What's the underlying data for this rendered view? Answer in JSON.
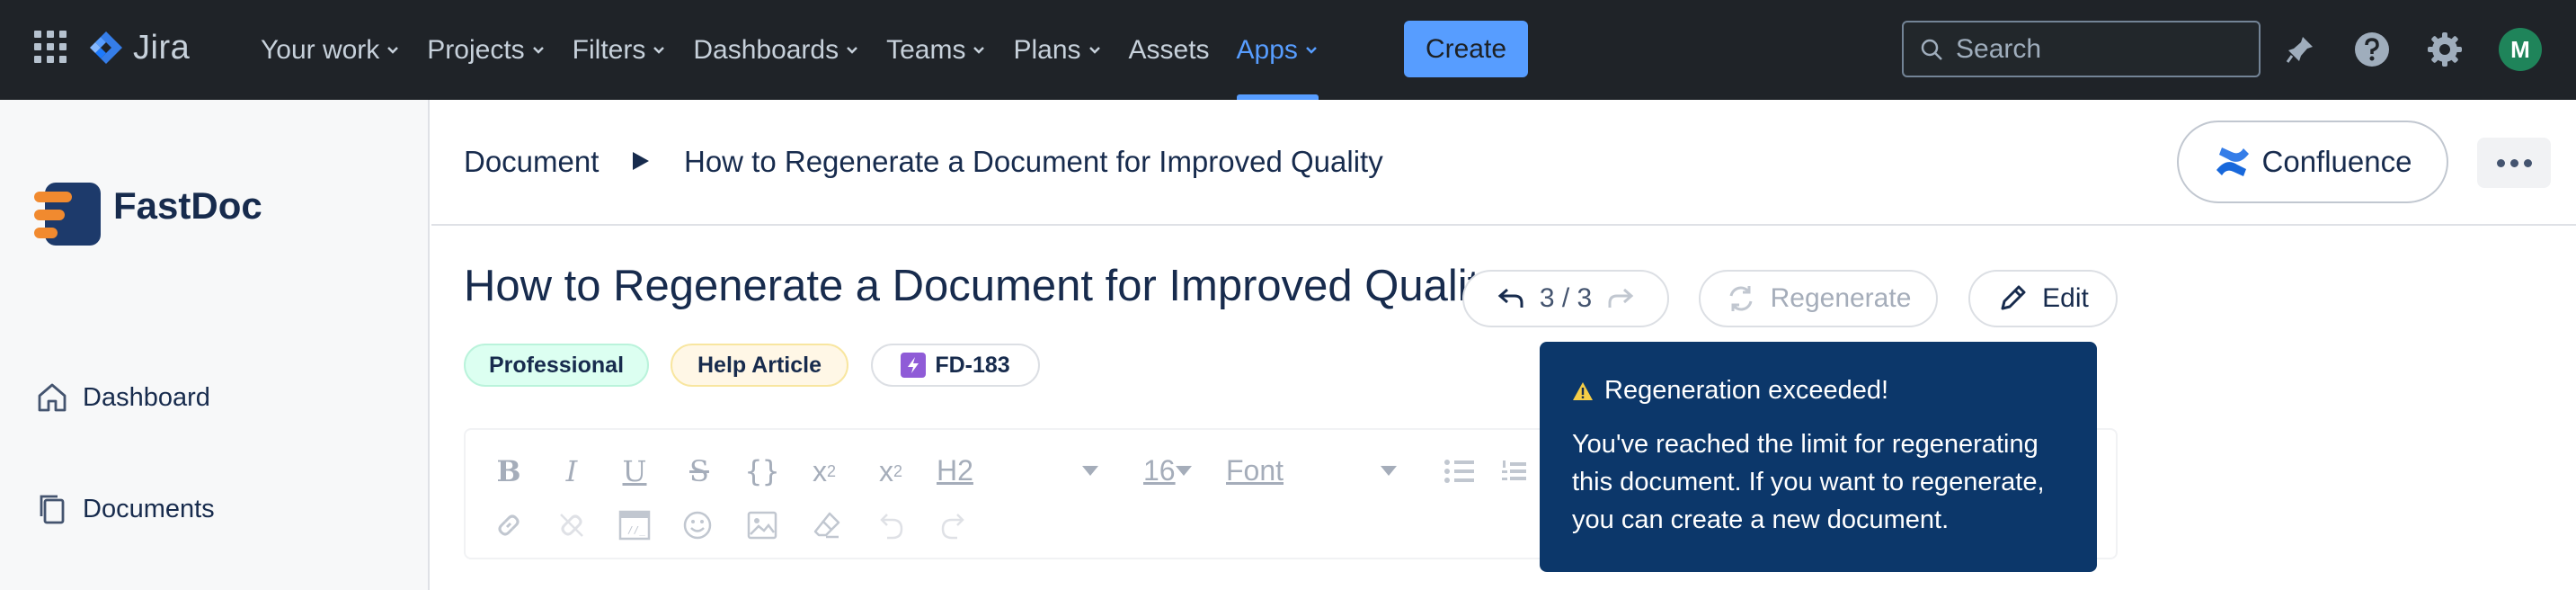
{
  "topnav": {
    "product": "Jira",
    "items": [
      {
        "label": "Your work",
        "dropdown": true
      },
      {
        "label": "Projects",
        "dropdown": true
      },
      {
        "label": "Filters",
        "dropdown": true
      },
      {
        "label": "Dashboards",
        "dropdown": true
      },
      {
        "label": "Teams",
        "dropdown": true
      },
      {
        "label": "Plans",
        "dropdown": true
      },
      {
        "label": "Assets",
        "dropdown": false
      },
      {
        "label": "Apps",
        "dropdown": true,
        "active": true
      }
    ],
    "create_label": "Create",
    "search_placeholder": "Search",
    "avatar_initial": "M",
    "colors": {
      "bg": "#1f2328",
      "accent": "#579dff",
      "avatar": "#1f845a"
    }
  },
  "sidebar": {
    "app_name": "FastDoc",
    "items": [
      {
        "label": "Dashboard",
        "icon": "home-icon"
      },
      {
        "label": "Documents",
        "icon": "documents-icon"
      }
    ]
  },
  "header": {
    "breadcrumb_root": "Document",
    "breadcrumb_current": "How to Regenerate a Document for Improved Quality",
    "confluence_label": "Confluence"
  },
  "document": {
    "title": "How to Regenerate a Document for Improved Quality",
    "version": "3 / 3",
    "regenerate_label": "Regenerate",
    "edit_label": "Edit",
    "tags": [
      {
        "label": "Professional",
        "color": "#dcfff1"
      },
      {
        "label": "Help Article",
        "color": "#fff7e6"
      },
      {
        "label": "FD-183",
        "color": "#ffffff"
      }
    ]
  },
  "editor": {
    "heading_value": "H2",
    "font_size_value": "16",
    "font_value": "Font"
  },
  "tooltip": {
    "title": "Regeneration exceeded!",
    "body": "You've reached the limit for regenerating this document. If you want to regenerate, you can create a new document.",
    "bg_color": "#0c376a"
  }
}
